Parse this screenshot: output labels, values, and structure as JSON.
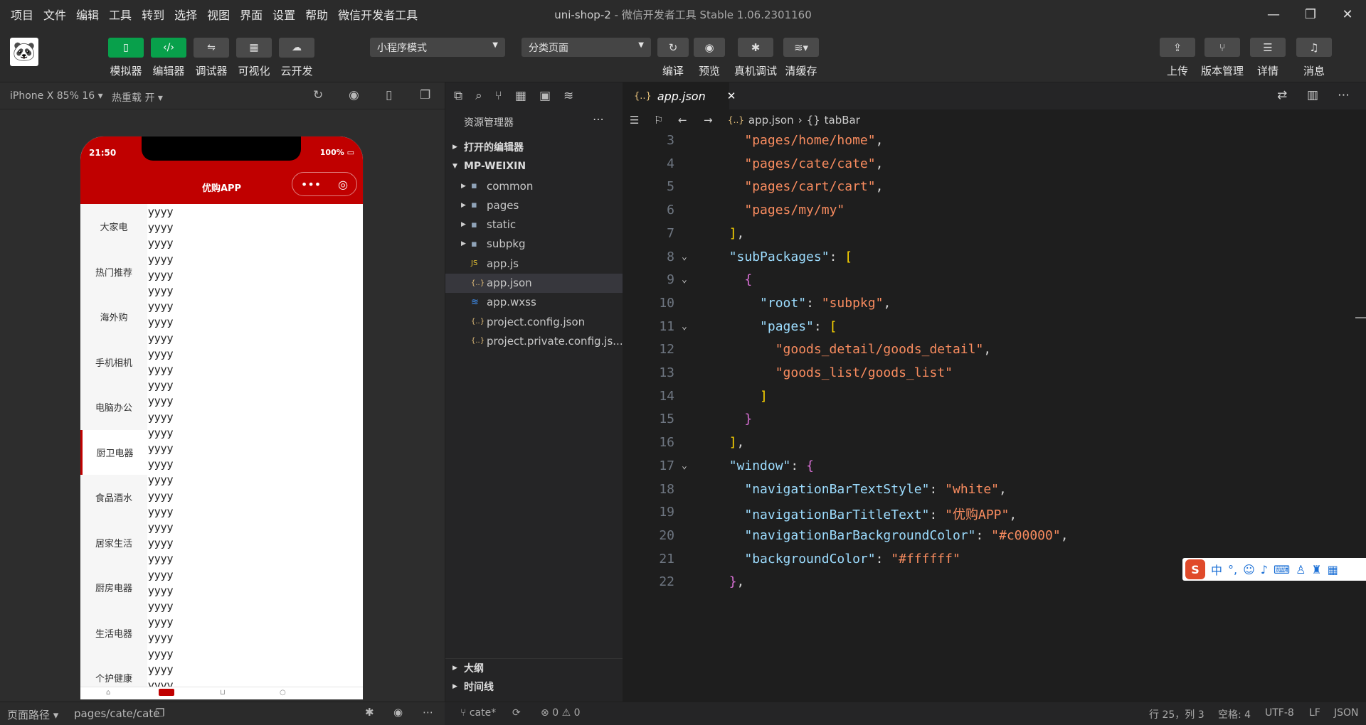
{
  "menu": [
    "项目",
    "文件",
    "编辑",
    "工具",
    "转到",
    "选择",
    "视图",
    "界面",
    "设置",
    "帮助",
    "微信开发者工具"
  ],
  "window": {
    "title_project": "uni-shop-2",
    "title_sep": " - ",
    "title_app": "微信开发者工具 Stable 1.06.2301160"
  },
  "toolbar": {
    "left_labels": [
      "模拟器",
      "编辑器",
      "调试器",
      "可视化",
      "云开发"
    ],
    "mode_select": "小程序模式",
    "page_select": "分类页面",
    "mid_labels": [
      "编译",
      "预览",
      "真机调试",
      "清缓存"
    ],
    "right_labels": [
      "上传",
      "版本管理",
      "详情",
      "消息"
    ]
  },
  "simulator": {
    "device": "iPhone X 85% 16",
    "hot_reload": "热重载 开",
    "time": "21:50",
    "battery": "100%",
    "page_title": "优购APP",
    "categories": [
      "大家电",
      "热门推荐",
      "海外购",
      "手机相机",
      "电脑办公",
      "厨卫电器",
      "食品酒水",
      "居家生活",
      "厨房电器",
      "生活电器",
      "个护健康"
    ],
    "active_category": 5,
    "item_text": "yyyy",
    "path_label": "页面路径",
    "path": "pages/cate/cate"
  },
  "explorer": {
    "title": "资源管理器",
    "open_editors": "打开的编辑器",
    "root": "MP-WEIXIN",
    "items": [
      {
        "name": "common",
        "type": "folder"
      },
      {
        "name": "pages",
        "type": "folder"
      },
      {
        "name": "static",
        "type": "folder"
      },
      {
        "name": "subpkg",
        "type": "folder"
      },
      {
        "name": "app.js",
        "type": "js"
      },
      {
        "name": "app.json",
        "type": "json"
      },
      {
        "name": "app.wxss",
        "type": "css"
      },
      {
        "name": "project.config.json",
        "type": "json"
      },
      {
        "name": "project.private.config.js...",
        "type": "json"
      }
    ],
    "selected": 5,
    "outline": "大纲",
    "timeline": "时间线"
  },
  "editor": {
    "tab": "app.json",
    "breadcrumb_file": "app.json",
    "breadcrumb_symbol": "tabBar",
    "lines": [
      {
        "n": "3",
        "t": "    \"pages/home/home\","
      },
      {
        "n": "4",
        "t": "    \"pages/cate/cate\","
      },
      {
        "n": "5",
        "t": "    \"pages/cart/cart\","
      },
      {
        "n": "6",
        "t": "    \"pages/my/my\""
      },
      {
        "n": "7",
        "t": "  ],"
      },
      {
        "n": "8",
        "t": "  \"subPackages\": ["
      },
      {
        "n": "9",
        "t": "    {"
      },
      {
        "n": "10",
        "t": "      \"root\": \"subpkg\","
      },
      {
        "n": "11",
        "t": "      \"pages\": ["
      },
      {
        "n": "12",
        "t": "        \"goods_detail/goods_detail\","
      },
      {
        "n": "13",
        "t": "        \"goods_list/goods_list\""
      },
      {
        "n": "14",
        "t": "      ]"
      },
      {
        "n": "15",
        "t": "    }"
      },
      {
        "n": "16",
        "t": "  ],"
      },
      {
        "n": "17",
        "t": "  \"window\": {"
      },
      {
        "n": "18",
        "t": "    \"navigationBarTextStyle\": \"white\","
      },
      {
        "n": "19",
        "t": "    \"navigationBarTitleText\": \"优购APP\","
      },
      {
        "n": "20",
        "t": "    \"navigationBarBackgroundColor\": \"#c00000\","
      },
      {
        "n": "21",
        "t": "    \"backgroundColor\": \"#ffffff\""
      },
      {
        "n": "22",
        "t": "  },"
      }
    ]
  },
  "status": {
    "branch": "cate*",
    "errors": "0",
    "warnings": "0",
    "position": "行 25，列 3",
    "spaces": "空格: 4",
    "encoding": "UTF-8",
    "eol": "LF",
    "language": "JSON"
  },
  "ime": {
    "mode": "中"
  },
  "colors": {
    "accent_green": "#08a04b",
    "nav_red": "#c00000",
    "editor_bg": "#1e1e1e"
  }
}
